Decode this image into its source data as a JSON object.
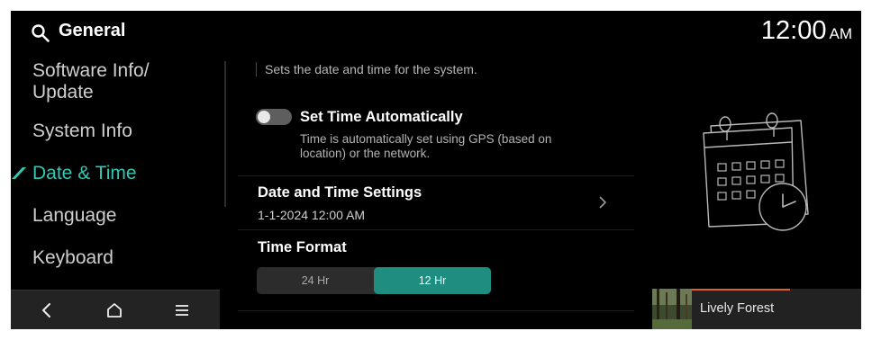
{
  "header": {
    "title": "General",
    "search_icon": "search-icon",
    "clock_time": "12:00",
    "clock_ampm": "AM"
  },
  "sidebar": {
    "items": [
      {
        "label": "Software Info/\nUpdate",
        "active": false
      },
      {
        "label": "System Info",
        "active": false
      },
      {
        "label": "Date & Time",
        "active": true
      },
      {
        "label": "Language",
        "active": false
      },
      {
        "label": "Keyboard",
        "active": false
      }
    ],
    "accent_color": "#32c8b4"
  },
  "bottom_nav": {
    "icons": [
      "back-icon",
      "home-icon",
      "menu-icon"
    ]
  },
  "content": {
    "description": "Sets the date and time for the system.",
    "auto_time": {
      "title": "Set Time Automatically",
      "description": "Time is automatically set using GPS (based on location) or the network.",
      "enabled": false
    },
    "date_time_settings": {
      "title": "Date and Time Settings",
      "value": "1-1-2024 12:00 AM"
    },
    "time_format": {
      "title": "Time Format",
      "options": [
        "24 Hr",
        "12 Hr"
      ],
      "selected": "12 Hr",
      "selected_color": "#1f8e80"
    },
    "illustration": "calendar-clock-icon"
  },
  "media": {
    "title": "Lively Forest",
    "progress": 0.58,
    "progress_color": "#e0602a"
  }
}
